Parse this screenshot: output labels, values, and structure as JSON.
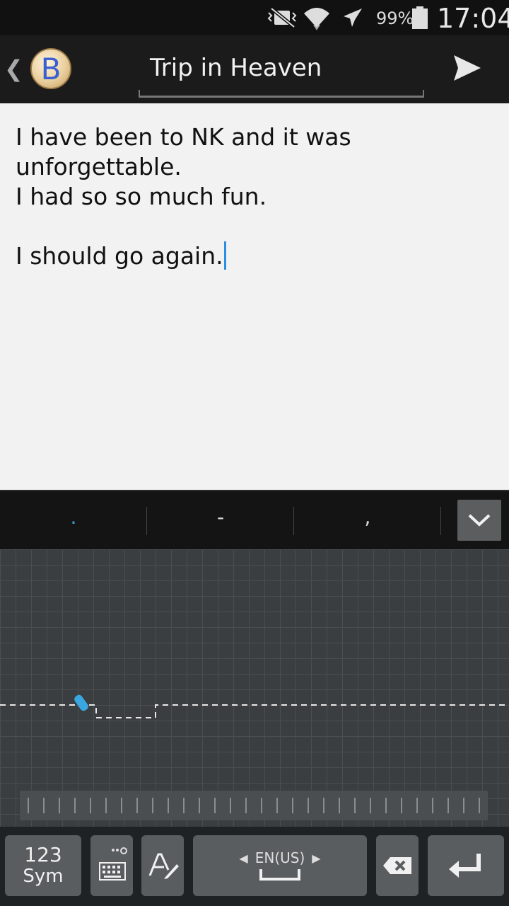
{
  "status_bar": {
    "icons": [
      "vibrate-mute-icon",
      "wifi-icon",
      "airplane-mode-icon"
    ],
    "battery_text": "99%",
    "time": "17:04"
  },
  "header": {
    "back_icon": "chevron-left-icon",
    "avatar_letter": "B",
    "title": "Trip in Heaven",
    "send_icon": "send-icon"
  },
  "editor": {
    "body": "I have been to NK and it was\nunforgettable.\nI had so so much fun.\n\nI should go again."
  },
  "suggestions": {
    "items": [
      ".",
      "-",
      ","
    ],
    "collapse_icon": "chevron-down-icon"
  },
  "keyboard": {
    "sym_line1": "123",
    "sym_line2": "Sym",
    "language": "EN(US)",
    "icons": [
      "keyboard-settings-icon",
      "handwriting-mode-icon",
      "space-icon",
      "backspace-icon",
      "enter-icon"
    ]
  },
  "colors": {
    "cursor": "#2a8fe0",
    "accent_dot": "#3aa7e0",
    "avatar_letter": "#3b5fd1"
  }
}
